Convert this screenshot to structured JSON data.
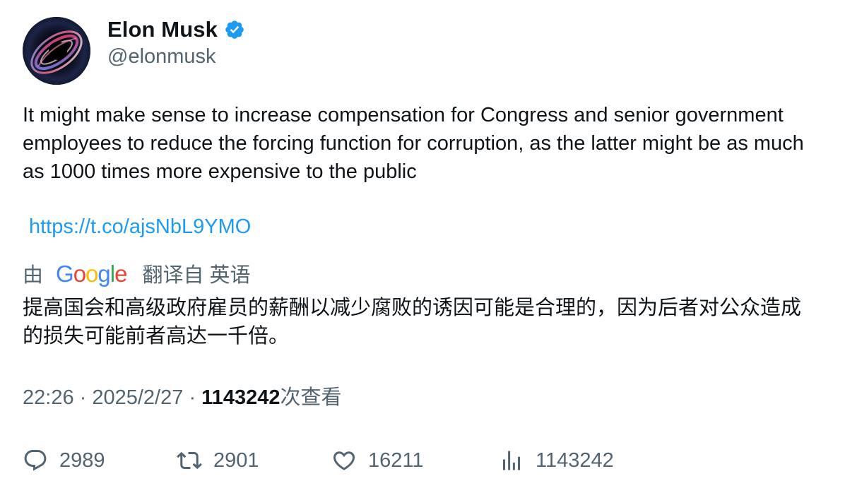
{
  "author": {
    "display_name": "Elon Musk",
    "handle": "@elonmusk",
    "verified_icon": "verified-badge-icon",
    "avatar": "black-hole-avatar"
  },
  "tweet": {
    "text": "It might make sense to increase compensation for Congress and senior government employees to reduce the forcing function for corruption, as the latter might be as much as 1000 times more expensive to the public",
    "link": "https://t.co/ajsNbL9YMO"
  },
  "translation": {
    "by_label": "由",
    "google_logo": "Google",
    "translated_from_label": "翻译自 英语",
    "translated_text": "提高国会和高级政府雇员的薪酬以减少腐败的诱因可能是合理的，因为后者对公众造成的损失可能前者高达一千倍。"
  },
  "meta": {
    "time": "22:26",
    "separator": "·",
    "date": "2025/2/27",
    "views_count": "1143242",
    "views_label": "次查看"
  },
  "actions": {
    "replies": "2989",
    "retweets": "2901",
    "likes": "16211",
    "views": "1143242"
  },
  "colors": {
    "link": "#1d9bf0",
    "secondary_text": "#536471",
    "primary_text": "#0f1419",
    "verified": "#1d9bf0"
  }
}
